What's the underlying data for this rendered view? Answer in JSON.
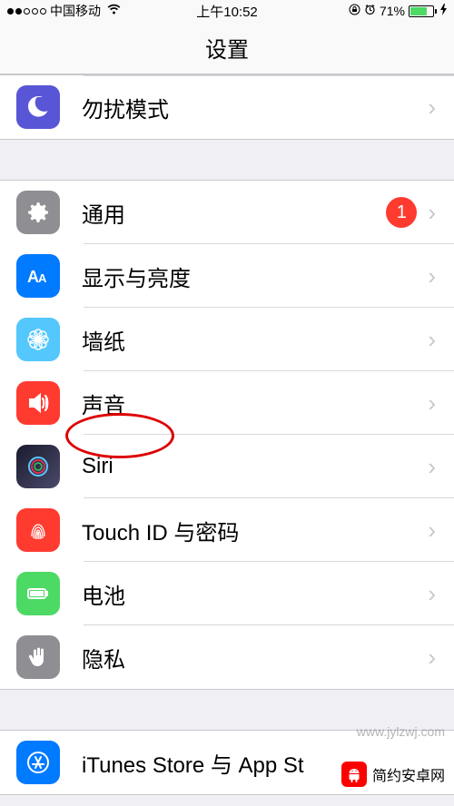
{
  "statusBar": {
    "carrier": "中国移动",
    "time": "上午10:52",
    "batteryPercent": "71%"
  },
  "header": {
    "title": "设置"
  },
  "group1": {
    "dnd": "勿扰模式"
  },
  "group2": {
    "general": "通用",
    "generalBadge": "1",
    "display": "显示与亮度",
    "wallpaper": "墙纸",
    "sound": "声音",
    "siri": "Siri",
    "touchid": "Touch ID 与密码",
    "battery": "电池",
    "privacy": "隐私"
  },
  "group3": {
    "itunes": "iTunes Store 与 App St"
  },
  "watermark1": "www.jylzwj.com",
  "watermark2": "简约安卓网"
}
